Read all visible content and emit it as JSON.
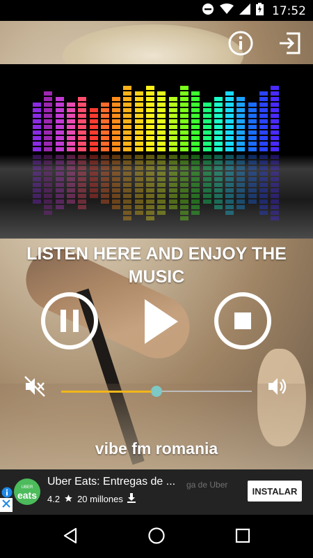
{
  "status_bar": {
    "time": "17:52",
    "icons": [
      "do-not-disturb-icon",
      "wifi-icon",
      "signal-icon",
      "battery-charging-icon"
    ]
  },
  "top_bar": {
    "info_icon": "info-icon",
    "exit_icon": "exit-icon"
  },
  "headline": "LISTEN HERE AND ENJOY THE MUSIC",
  "controls": {
    "pause": "pause-icon",
    "play": "play-icon",
    "stop": "stop-icon"
  },
  "volume": {
    "mute_icon": "volume-mute-icon",
    "up_icon": "volume-up-icon",
    "level": 0.5,
    "filled_color": "#f2b619",
    "thumb_color": "#7ec8c6"
  },
  "station_name": "vibe fm romania",
  "equalizer": {
    "levels": [
      9,
      11,
      10,
      9,
      10,
      8,
      9,
      10,
      12,
      11,
      12,
      11,
      10,
      12,
      11,
      9,
      10,
      11,
      10,
      9,
      11,
      12
    ],
    "colors": [
      "#8a2be2",
      "#9b27b0",
      "#c13ad4",
      "#e94bb2",
      "#ff4d6d",
      "#ff3b30",
      "#ff6b2b",
      "#ff8c1a",
      "#ffb11a",
      "#ffd21a",
      "#fff11a",
      "#e6ff1a",
      "#b5ff1a",
      "#7cff1a",
      "#3cff30",
      "#1aff7a",
      "#1affc7",
      "#1ad9ff",
      "#1aa3ff",
      "#1a6dff",
      "#2a44ff",
      "#4a2aff"
    ]
  },
  "ad": {
    "logo_text": "eats",
    "logo_subtext": "UBER",
    "title": "Uber Eats: Entregas de ...",
    "ghost_text": "ga de Uber",
    "rating": "4.2",
    "installs": "20 millones",
    "cta": "INSTALAR"
  },
  "navbar": {
    "back": "back-icon",
    "home": "home-icon",
    "recents": "recents-icon"
  }
}
